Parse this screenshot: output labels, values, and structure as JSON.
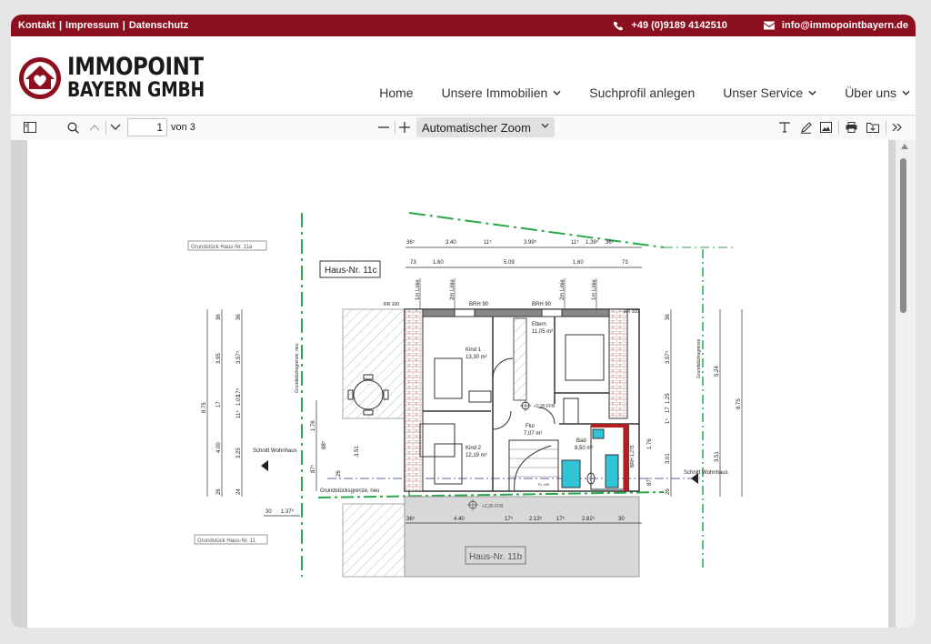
{
  "topbar": {
    "links": [
      "Kontakt",
      "|",
      "Impressum",
      "|",
      "Datenschutz"
    ],
    "phone": "+49 (0)9189 4142510",
    "email": "info@immopointbayern.de"
  },
  "brand": {
    "line1": "IMMOPOINT",
    "line2": "BAYERN GMBH",
    "accent": "#8c1020"
  },
  "nav": {
    "items": [
      {
        "label": "Home",
        "dropdown": false
      },
      {
        "label": "Unsere Immobilien",
        "dropdown": true
      },
      {
        "label": "Suchprofil anlegen",
        "dropdown": false
      },
      {
        "label": "Unser Service",
        "dropdown": true
      },
      {
        "label": "Über uns",
        "dropdown": true
      }
    ]
  },
  "pdf_toolbar": {
    "page_value": "1",
    "page_count": "von 3",
    "zoom": "Automatischer Zoom",
    "icons": [
      "sidebar-toggle-icon",
      "search-icon",
      "previous-page-icon",
      "next-page-icon",
      "zoom-out-icon",
      "zoom-in-icon",
      "text-tool-icon",
      "draw-tool-icon",
      "image-tool-icon",
      "print-icon",
      "download-icon",
      "more-tools-icon"
    ]
  },
  "plan": {
    "house_label": "Haus-Nr. 11c",
    "house_below": "Haus-Nr. 11b",
    "grundstueck_top": "Grundstück Haus-Nr. 11a",
    "grundstueck_bottom": "Grundstück Haus-Nr. 11",
    "grundstuecksgrenze": "Grundstücksgrenze, neu",
    "grenze_vertical": "Grundstücksgrenze, neu",
    "grenze_right": "Grundstücksgrenze",
    "schnitt_left": "Schnitt Wohnhaus",
    "schnitt_right": "Schnitt Wohnhaus",
    "rooms": [
      {
        "name": "Kind 1",
        "area": "13,30 m²"
      },
      {
        "name": "Eltern",
        "area": "11,05 m²"
      },
      {
        "name": "Flur",
        "area": "7,07 m²"
      },
      {
        "name": "Kind 2",
        "area": "12,19 m²"
      },
      {
        "name": "Bad",
        "area": "8,50 m²"
      }
    ],
    "ffb": "+2,95 FFB",
    "ffb_below": "+2,95 FFB",
    "brh_left": "BRH 90",
    "brh_right": "BRH 90",
    "brh_bad": "BRH 1,275",
    "rr_left": "RR 100",
    "rr_right": "RR 100",
    "lines": [
      "1m Linie",
      "2m Linie",
      "2m Linie",
      "1m Linie"
    ],
    "dims_top1": [
      "36⁵",
      "3.40",
      "11⁵",
      "3.99⁵",
      "11⁵",
      "1.39⁵",
      "36⁵"
    ],
    "dims_top2": [
      "73",
      "1.60",
      "5.09",
      "1.60",
      "73"
    ],
    "dims_bottom": [
      "36⁵",
      "4.40",
      "17⁵",
      "2.13⁵",
      "17⁵",
      "2.82⁵",
      "30"
    ],
    "dims_left": [
      "8.75",
      "36",
      "3.95",
      "17",
      "4.00",
      "26",
      "36",
      "3.57⁵",
      "11⁵",
      "1.01",
      "17⁵",
      "3.25",
      "24"
    ],
    "dims_right": [
      "36",
      "3.57⁵",
      "1.25",
      "17",
      "1⁵",
      "3.01",
      "1.76",
      "87⁵",
      "26",
      "5.24",
      "3.51",
      "8.75"
    ],
    "misc": [
      "1.76",
      "88⁵",
      "87⁵",
      "26",
      "3.51",
      "30",
      "1.37⁵",
      "FL 100"
    ]
  }
}
